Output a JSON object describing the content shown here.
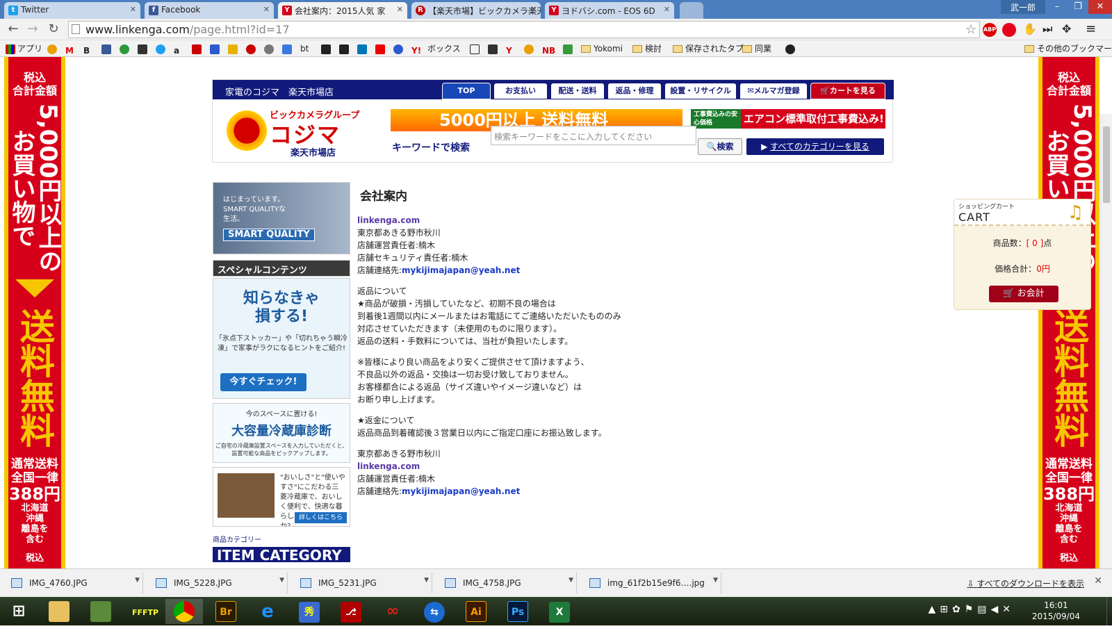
{
  "tabs": [
    {
      "label": "Twitter",
      "favicon": "twitter-icon",
      "color": "#1da1f2"
    },
    {
      "label": "Facebook",
      "favicon": "facebook-icon",
      "color": "#3b5998"
    },
    {
      "label": "会社案内：2015人気 家",
      "favicon": "yahoo-icon",
      "color": "#d6001c"
    },
    {
      "label": "【楽天市場】ビックカメラ楽天",
      "favicon": "rakuten-icon",
      "color": "#bf0000"
    },
    {
      "label": "ヨドバシ.com - EOS 6D",
      "favicon": "yahoo-icon",
      "color": "#d6001c"
    }
  ],
  "user_name": "武一郎",
  "address": {
    "host": "www.linkenga.com",
    "path": "/page.html?id=17"
  },
  "bookmarks": {
    "apps": "アプリ",
    "items": [
      "bt",
      "ボックス",
      "Yokomi",
      "検討",
      "保存されたタブ",
      "同業"
    ],
    "other": "その他のブックマーク"
  },
  "side_banner": {
    "line1": "税込",
    "line2": "合計金額",
    "amount": "5,000円",
    "buy": "以上のお買い物で",
    "free": "送料無料",
    "normal": "通常送料",
    "flat": "全国一律",
    "price": "388円",
    "except": "北海道",
    "except2": "沖縄",
    "except3": "離島を",
    "except4": "含む",
    "next": "税込"
  },
  "header": {
    "store": "家電のコジマ　楽天市場店",
    "nav": [
      "TOP",
      "お支払い",
      "配送・送料",
      "返品・修理",
      "設置・リサイクル",
      "メルマガ登録",
      "カートを見る"
    ],
    "logo_top": "ビックカメラグループ",
    "logo_main": "コジマ",
    "logo_sub": "楽天市場店",
    "banner1": "5000円以上 送料無料",
    "banner2_green": "工事費込みの安心価格",
    "banner2_text": "エアコン標準取付工事費込み!",
    "keyword_label": "キーワードで検索",
    "search_placeholder": "検索キーワードをここに入力してください",
    "search_button": "検索",
    "all_categories": "すべてのカテゴリーを見る"
  },
  "left": {
    "sq_line1": "はじまっています。",
    "sq_line2": "SMART QUALITYな",
    "sq_line3": "生活。",
    "sq_badge": "SMART QUALITY",
    "special": "スペシャルコンテンツ",
    "sp1_big1": "知らなきゃ",
    "sp1_big2": "損する!",
    "sp1_small": "「氷点下ストッカー」や「切れちゃう瞬冷凍」で家事がラクになるヒントをご紹介!",
    "sp1_check": "今すぐチェック!",
    "sp2_small": "今のスペースに置ける!",
    "sp2_big": "大容量冷蔵庫診断",
    "sp2_small2": "ご自宅の冷蔵庫設置スペースを入力していただくと、設置可能な商品をピックアップします。",
    "sp3_text": "\"おいしさ\"と\"使いやすさ\"にこだわる三菱冷蔵庫で、おいしく便利で、快適な暮らし、はじめませんか?",
    "sp3_more": "詳しくはこちら",
    "itemcat_small": "商品カテゴリー",
    "itemcat_big": "ITEM CATEGORY"
  },
  "main": {
    "title": "会社案内",
    "site": "linkenga.com",
    "address": "東京都あきる野市秋川",
    "manager": "店舗運営責任者:楠木",
    "security": "店舗セキュリティ責任者:楠木",
    "contact_label": "店舗連絡先:",
    "email": "mykijimajapan@yeah.net",
    "return_head": "返品について",
    "return1": "★商品が破損・汚損していたなど、初期不良の場合は",
    "return2": "到着後1週間以内にメールまたはお電話にてご連絡いただいたもののみ",
    "return3": "対応させていただきます（未使用のものに限ります）。",
    "return4": "返品の送料・手数料については、当社が負担いたします。",
    "note1": "※皆様により良い商品をより安くご提供させて頂けますよう、",
    "note2": "不良品以外の返品・交換は一切お受け致しておりません。",
    "note3": "お客様都合による返品（サイズ違いやイメージ違いなど）は",
    "note4": "お断り申し上げます。",
    "refund_head": "★返金について",
    "refund1": "返品商品到着確認後３営業日以内にご指定口座にお振込致します。",
    "address2": "東京都あきる野市秋川",
    "site2": "linkenga.com",
    "manager2": "店舗運営責任者:楠木",
    "contact_label2": "店舗連絡先:",
    "email2": "mykijimajapan@yeah.net"
  },
  "cart": {
    "small": "ショッピングカート",
    "big": "CART",
    "count_label": "商品数：",
    "count": "[ 0 ]",
    "count_unit": "点",
    "total_label": "価格合計：",
    "total": "0円",
    "pay": "お会計"
  },
  "downloads": [
    "IMG_4760.JPG",
    "IMG_5228.JPG",
    "IMG_5231.JPG",
    "IMG_4758.JPG",
    "img_61f2b15e9f6….jpg"
  ],
  "downloads_all": "すべてのダウンロードを表示",
  "clock": {
    "time": "16:01",
    "date": "2015/09/04"
  },
  "colors": {
    "kojima_navy": "#111a7a",
    "banner_red": "#d7001a",
    "banner_yellow": "#f7c600"
  }
}
